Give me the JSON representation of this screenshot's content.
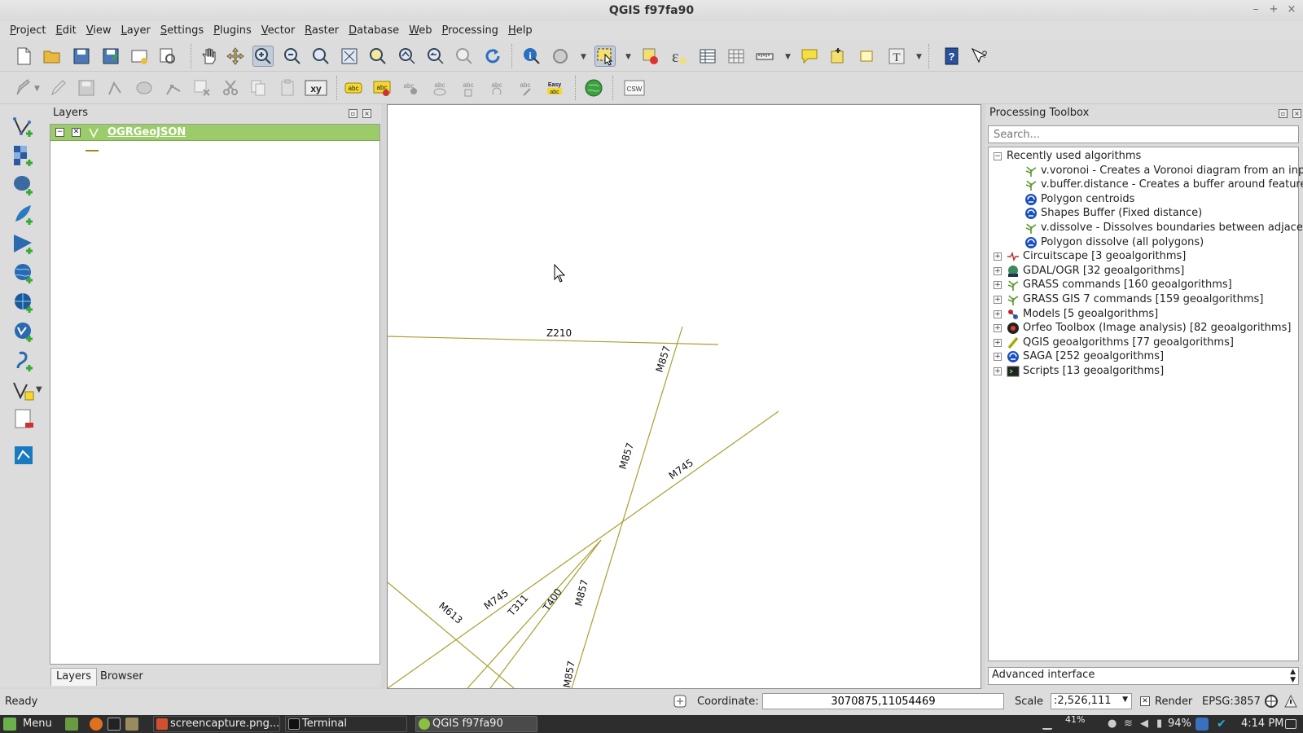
{
  "window": {
    "title": "QGIS f97fa90",
    "controls": [
      "–",
      "+",
      "×"
    ]
  },
  "menu": [
    "Project",
    "Edit",
    "View",
    "Layer",
    "Settings",
    "Plugins",
    "Vector",
    "Raster",
    "Database",
    "Web",
    "Processing",
    "Help"
  ],
  "toolbar": {
    "xy_label": "xy",
    "csw_label": "CSW",
    "easy_label": "Easy abc",
    "abc_label": "abc",
    "text_label": "T",
    "help_label": "?"
  },
  "layers_panel": {
    "title": "Layers",
    "layer_name": "OGRGeoJSON",
    "tabs": [
      "Layers",
      "Browser"
    ]
  },
  "map": {
    "labels": [
      "Z210",
      "M857",
      "M857",
      "M745",
      "M745",
      "T311",
      "T400",
      "M857",
      "M613",
      "M857"
    ]
  },
  "toolbox": {
    "title": "Processing Toolbox",
    "search_placeholder": "Search...",
    "recent_group": "Recently used algorithms",
    "recent_items": [
      {
        "label": "v.voronoi - Creates a Voronoi diagram from an inpu...",
        "icon": "grass-icon"
      },
      {
        "label": "v.buffer.distance - Creates a buffer around features...",
        "icon": "grass-icon"
      },
      {
        "label": "Polygon centroids",
        "icon": "saga-icon"
      },
      {
        "label": "Shapes Buffer (Fixed distance)",
        "icon": "saga-icon"
      },
      {
        "label": "v.dissolve - Dissolves boundaries between adjacent...",
        "icon": "grass-icon"
      },
      {
        "label": "Polygon dissolve (all polygons)",
        "icon": "saga-icon"
      }
    ],
    "providers": [
      {
        "label": "Circuitscape [3 geoalgorithms]",
        "icon": "circuitscape-icon"
      },
      {
        "label": "GDAL/OGR [32 geoalgorithms]",
        "icon": "gdal-icon"
      },
      {
        "label": "GRASS commands [160 geoalgorithms]",
        "icon": "grass-icon"
      },
      {
        "label": "GRASS GIS 7 commands [159 geoalgorithms]",
        "icon": "grass-icon"
      },
      {
        "label": "Models [5 geoalgorithms]",
        "icon": "models-icon"
      },
      {
        "label": "Orfeo Toolbox (Image analysis) [82 geoalgorithms]",
        "icon": "orfeo-icon"
      },
      {
        "label": "QGIS geoalgorithms [77 geoalgorithms]",
        "icon": "qgis-icon"
      },
      {
        "label": "SAGA [252 geoalgorithms]",
        "icon": "saga-icon"
      },
      {
        "label": "Scripts [13 geoalgorithms]",
        "icon": "scripts-icon"
      }
    ],
    "interface_mode": "Advanced interface"
  },
  "status": {
    "ready": "Ready",
    "coordinate_label": "Coordinate:",
    "coordinate_value": "3070875,11054469",
    "scale_label": "Scale",
    "scale_value": ":2,526,111",
    "render_label": "Render",
    "crs": "EPSG:3857"
  },
  "taskbar": {
    "menu_label": "Menu",
    "items": [
      "screencapture.png...",
      "Terminal",
      "QGIS f97fa90"
    ],
    "battery_pct": "41%",
    "battery2": "94%",
    "clock": "4:14 PM"
  }
}
